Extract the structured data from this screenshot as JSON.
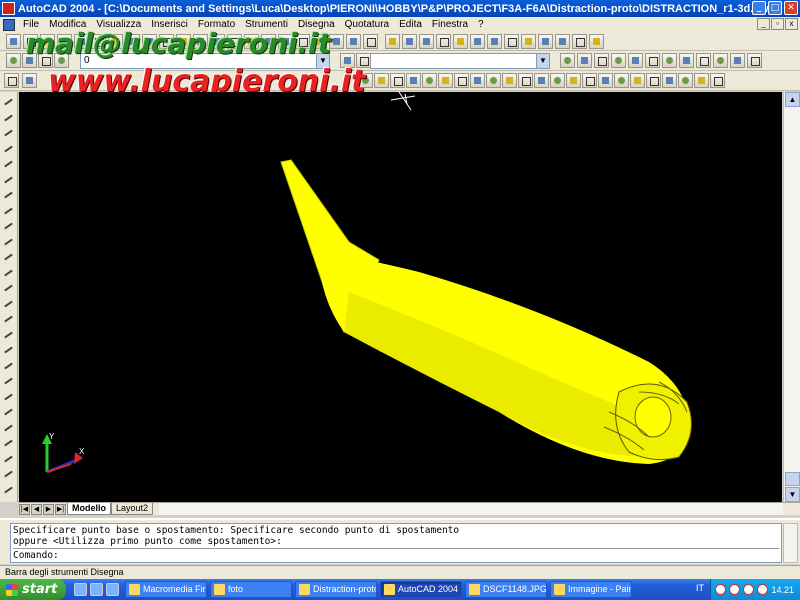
{
  "window": {
    "title": "AutoCAD 2004 - [C:\\Documents and Settings\\Luca\\Desktop\\PIERONI\\HOBBY\\P&P\\PROJECT\\F3A-F6A\\Distraction-proto\\DISTRACTION_r1-3d.dwg]",
    "minimize": "_",
    "maximize": "□",
    "close": "✕"
  },
  "menubar": {
    "items": [
      "File",
      "Modifica",
      "Visualizza",
      "Inserisci",
      "Formato",
      "Strumenti",
      "Disegna",
      "Quotatura",
      "Edita",
      "Finestra",
      "?"
    ]
  },
  "watermark": {
    "email": "mail@lucapieroni.it",
    "website": "www.lucapieroni.it"
  },
  "layer_combo": {
    "value": "0"
  },
  "layout_tabs": {
    "nav": [
      "|◀",
      "◀",
      "▶",
      "▶|"
    ],
    "tabs": [
      {
        "label": "Modello",
        "active": true
      },
      {
        "label": "Layout2",
        "active": false
      }
    ]
  },
  "command_line": {
    "history": [
      "Specificare punto base o spostamento: Specificare secondo punto di spostamento",
      "oppure <Utilizza primo punto come spostamento>:"
    ],
    "prompt": "Comando:"
  },
  "status_bar": {
    "text": "Barra degli strumenti Disegna"
  },
  "ucs": {
    "y_label": "Y",
    "x_label": "X"
  },
  "taskbar": {
    "start_label": "start",
    "tasks": [
      {
        "label": "Macromedia Fir...",
        "active": false
      },
      {
        "label": "foto",
        "active": false
      },
      {
        "label": "Distraction-proto",
        "active": false
      },
      {
        "label": "AutoCAD 2004 ...",
        "active": true
      },
      {
        "label": "DSCF1148.JPG...",
        "active": false
      },
      {
        "label": "Immagine - Paint",
        "active": false
      }
    ],
    "language": "IT",
    "clock": "14.21"
  },
  "colors": {
    "model_fill": "#ffff00",
    "model_shadow": "#c8c800",
    "viewport_bg": "#000000"
  }
}
